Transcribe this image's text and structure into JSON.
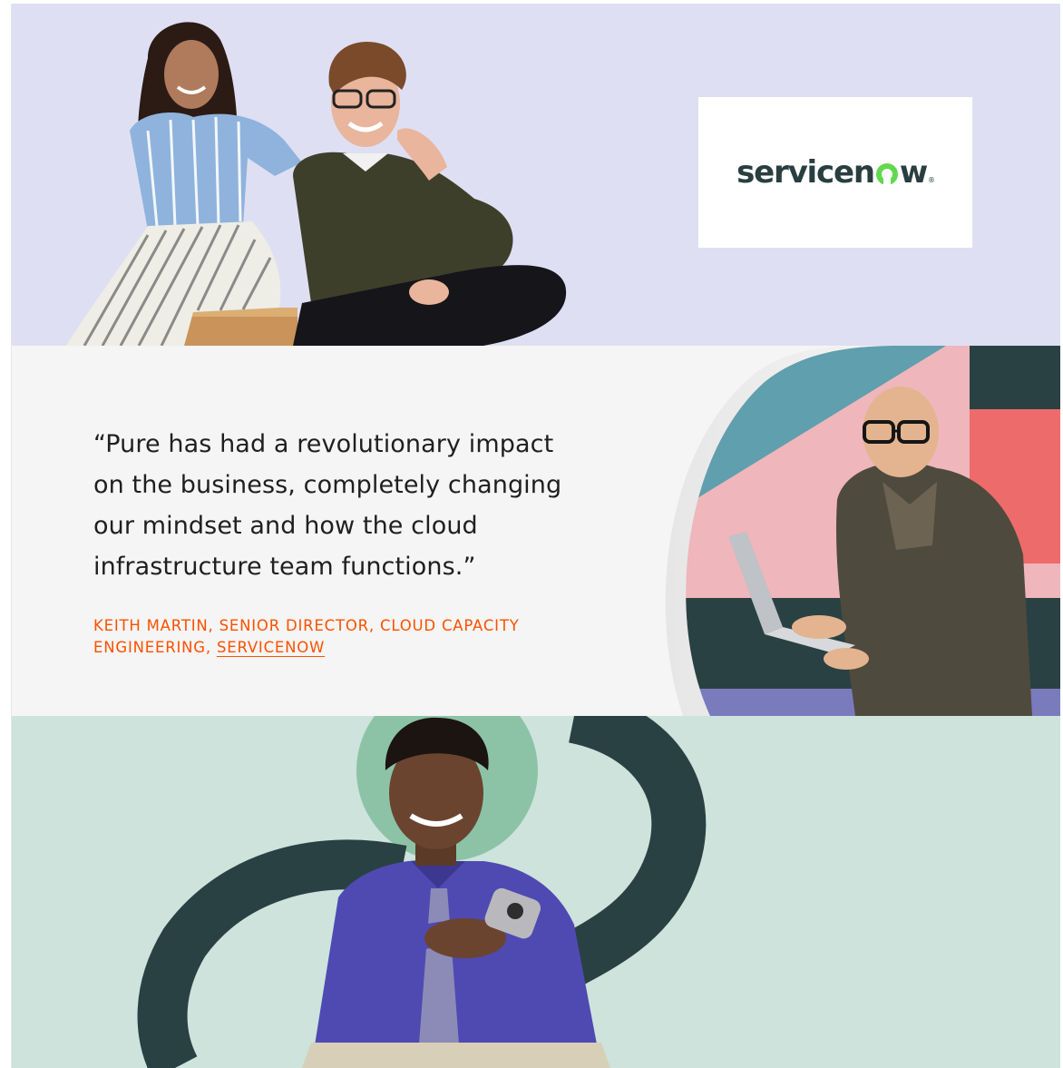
{
  "brand": {
    "logo_main": "servicen",
    "logo_tail": "w",
    "logo_reg": "®",
    "logo_color": "#293e40",
    "logo_accent": "#62d84e"
  },
  "quote": {
    "text": "“Pure has had a revolutionary impact on the business, completely changing our mindset and how the cloud infrastructure team functions.”",
    "attribution_prefix": "KEITH MARTIN, SENIOR DIRECTOR, CLOUD CAPACITY ENGINEERING, ",
    "attribution_link": "SERVICENOW"
  },
  "colors": {
    "hero_bg": "#dfdff3",
    "quote_bg": "#f5f5f5",
    "bottom_bg": "#cde3dc",
    "accent_orange": "#fe5000"
  },
  "images": {
    "hero_photo": "two-people-sitting-photo",
    "quote_photo": "man-with-laptop-photo",
    "bottom_photo": "man-with-phone-photo"
  }
}
